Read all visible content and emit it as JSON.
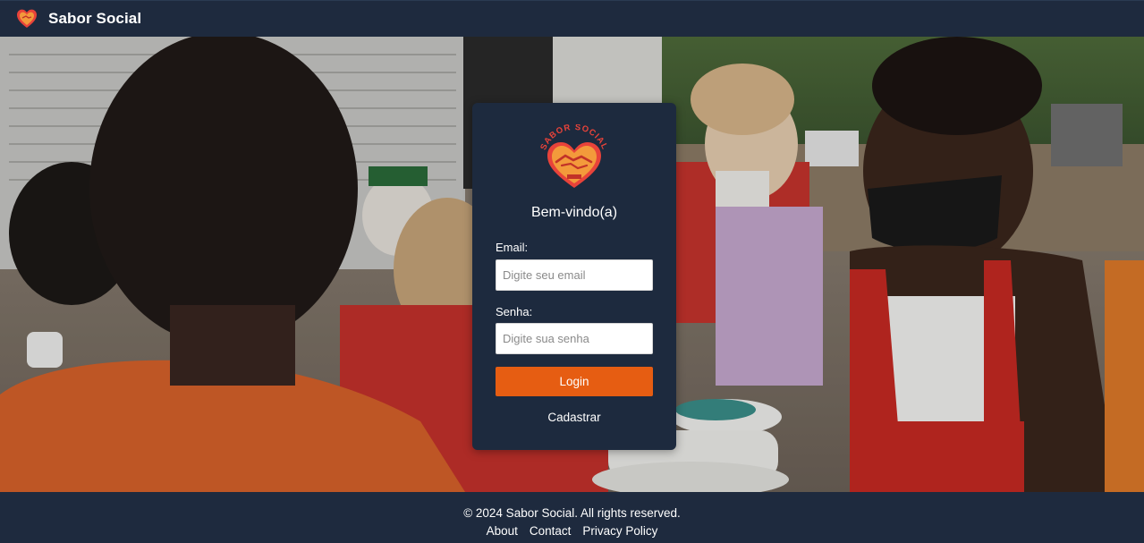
{
  "navbar": {
    "brand": "Sabor Social",
    "logo_icon": "heart-handshake-icon"
  },
  "hero": {
    "background": "photo-volunteers-distributing-food"
  },
  "login": {
    "logo_text_top": "SABOR SOCIAL",
    "welcome": "Bem-vindo(a)",
    "email_label": "Email:",
    "email_placeholder": "Digite seu email",
    "email_value": "",
    "password_label": "Senha:",
    "password_placeholder": "Digite sua senha",
    "password_value": "",
    "login_button": "Login",
    "register_link": "Cadastrar"
  },
  "footer": {
    "copyright": "© 2024 Sabor Social. All rights reserved.",
    "links": [
      "About",
      "Contact",
      "Privacy Policy"
    ]
  },
  "colors": {
    "navbar_bg": "#1e2a3e",
    "card_bg": "#1d2a3e",
    "accent": "#e65d12",
    "logo_red": "#e8433a",
    "logo_orange": "#f39a3b"
  }
}
